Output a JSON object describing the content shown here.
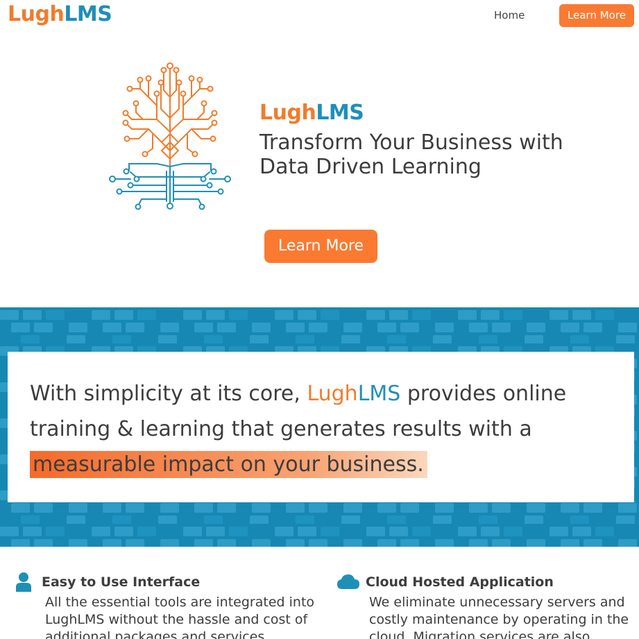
{
  "header": {
    "logo": {
      "part1": "Lugh",
      "part2": "LMS"
    },
    "nav": {
      "home_label": "Home",
      "cta_label": "Learn More"
    }
  },
  "hero": {
    "brand": {
      "part1": "Lugh",
      "part2": "LMS"
    },
    "tagline": "Transform Your Business with Data Driven Learning",
    "cta_label": "Learn More",
    "logo_icon": "circuit-tree-icon"
  },
  "banner": {
    "text_before": "With simplicity at its core, ",
    "brand": {
      "part1": "Lugh",
      "part2": "LMS"
    },
    "text_after": " provides online training & learning that generates results with a ",
    "highlight": "measurable impact on your business."
  },
  "features": [
    {
      "icon": "user-icon",
      "title": "Easy to Use Interface",
      "text": "All the essential tools are integrated into LughLMS without the hassle and cost of additional packages and services."
    },
    {
      "icon": "cloud-icon",
      "title": "Cloud Hosted Application",
      "text": "We eliminate unnecessary servers and costly maintenance by operating in the cloud. Migration services are also"
    }
  ],
  "colors": {
    "orange": "#fa7a32",
    "blue": "#1f8fb8",
    "banner_blue": "#1788b4"
  }
}
